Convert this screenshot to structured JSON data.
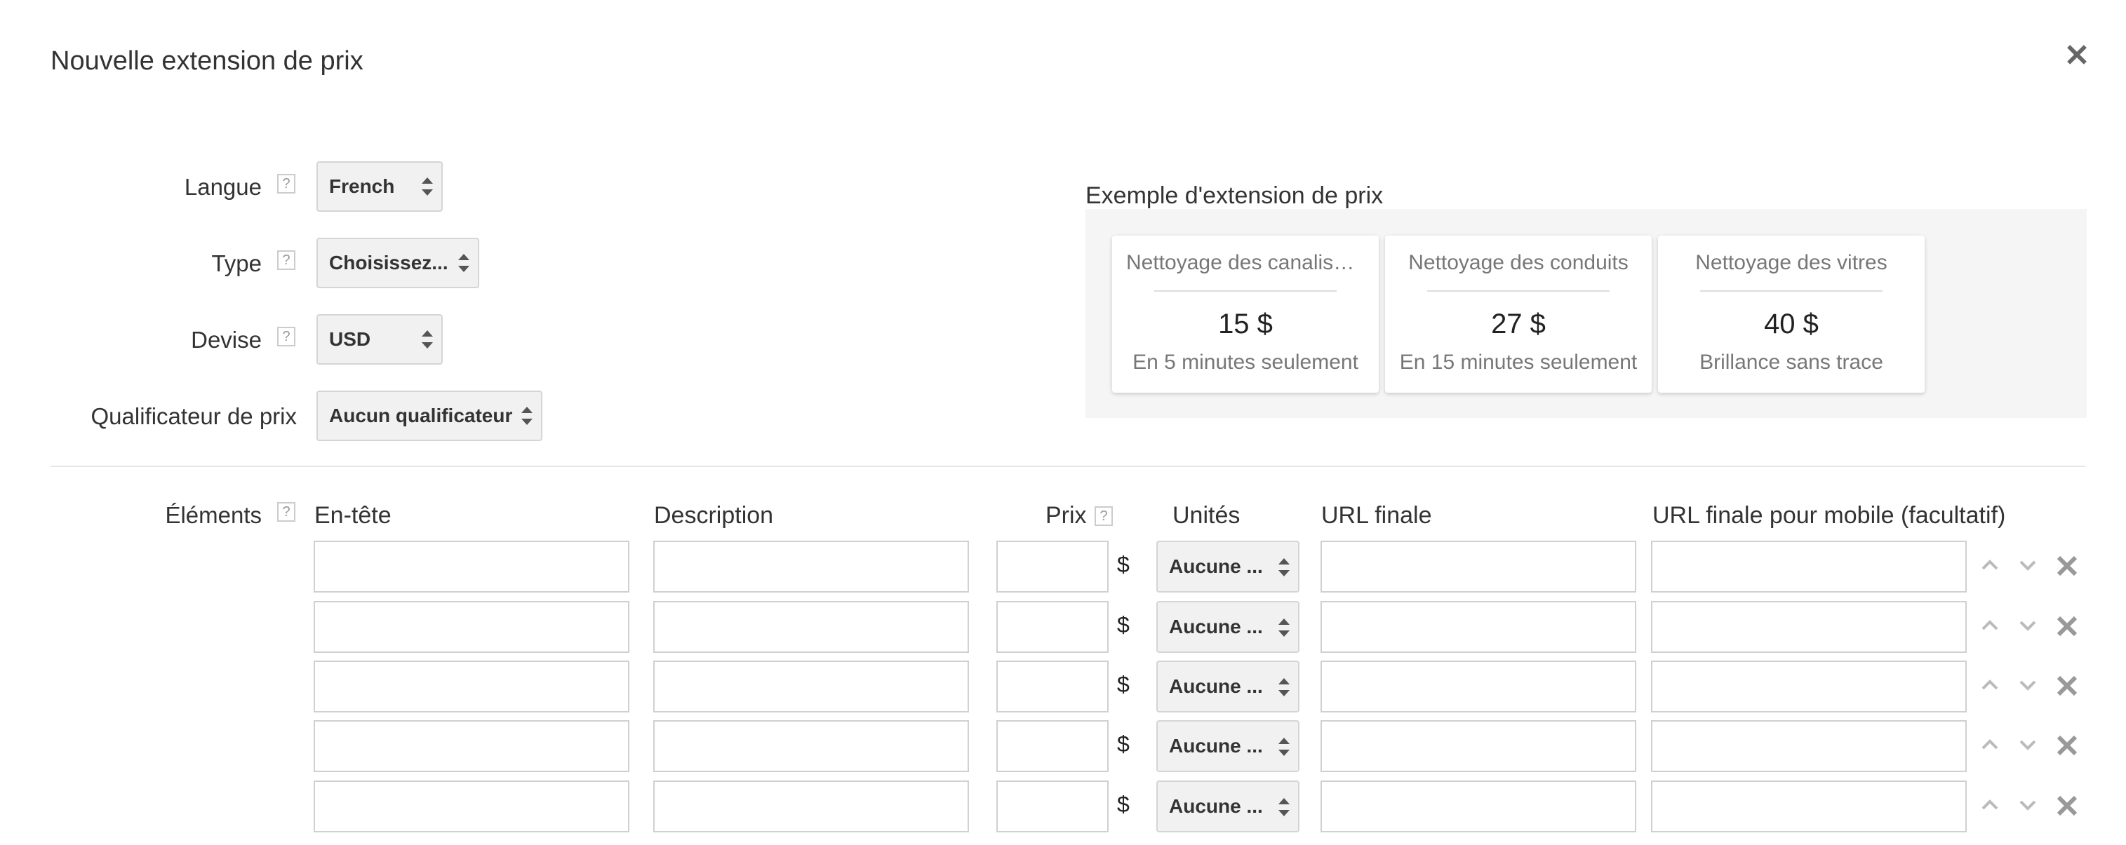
{
  "dialog": {
    "title": "Nouvelle extension de prix",
    "close_icon": "close-icon"
  },
  "form": {
    "language": {
      "label": "Langue",
      "help": "?",
      "value": "French"
    },
    "type": {
      "label": "Type",
      "help": "?",
      "value": "Choisissez..."
    },
    "currency": {
      "label": "Devise",
      "help": "?",
      "value": "USD"
    },
    "qualifier": {
      "label": "Qualificateur de prix",
      "value": "Aucun qualificateur"
    }
  },
  "preview": {
    "label": "Exemple d'extension de prix",
    "cards": [
      {
        "header": "Nettoyage des canalisations",
        "price": "15 $",
        "description": "En 5 minutes seulement"
      },
      {
        "header": "Nettoyage des conduits",
        "price": "27 $",
        "description": "En 15 minutes seulement"
      },
      {
        "header": "Nettoyage des vitres",
        "price": "40 $",
        "description": "Brillance sans trace"
      }
    ]
  },
  "items": {
    "label": "Éléments",
    "help": "?",
    "columns": {
      "header": "En-tête",
      "description": "Description",
      "price": "Prix",
      "price_help": "?",
      "units": "Unités",
      "final_url": "URL finale",
      "mobile_url": "URL finale pour mobile (facultatif)"
    },
    "currency_symbol": "$",
    "unit_value": "Aucune ...",
    "rows": [
      {
        "header": "",
        "description": "",
        "price": "",
        "final_url": "",
        "mobile_url": ""
      },
      {
        "header": "",
        "description": "",
        "price": "",
        "final_url": "",
        "mobile_url": ""
      },
      {
        "header": "",
        "description": "",
        "price": "",
        "final_url": "",
        "mobile_url": ""
      },
      {
        "header": "",
        "description": "",
        "price": "",
        "final_url": "",
        "mobile_url": ""
      },
      {
        "header": "",
        "description": "",
        "price": "",
        "final_url": "",
        "mobile_url": ""
      }
    ]
  },
  "icons": {
    "close": "close-icon",
    "help": "help-icon",
    "select_arrows": "sort-arrows-icon",
    "move_up": "chevron-up-icon",
    "move_down": "chevron-down-icon",
    "remove": "remove-icon"
  }
}
